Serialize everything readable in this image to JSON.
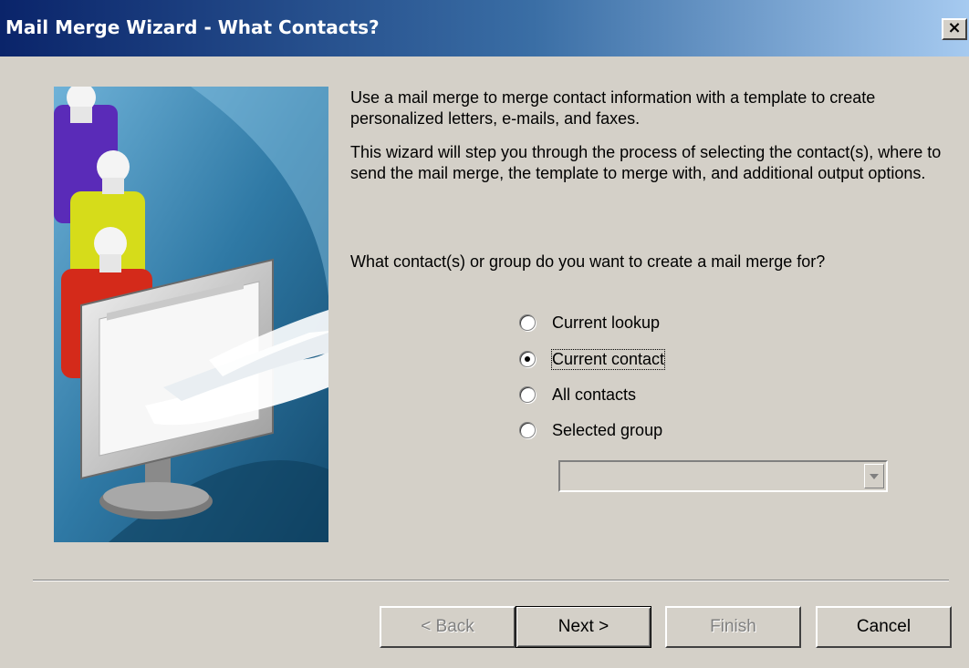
{
  "window": {
    "title": "Mail Merge Wizard - What Contacts?",
    "close_label": "×"
  },
  "intro": {
    "paragraph1": "Use a mail merge to merge contact information with a template to create personalized letters, e-mails, and faxes.",
    "paragraph2": "This wizard will step you through the process of selecting the contact(s), where to send the mail merge, the template to merge with, and additional output options.",
    "question": "What contact(s) or group do you want to create a mail merge for?"
  },
  "options": [
    {
      "label": "Current lookup",
      "checked": false
    },
    {
      "label": "Current contact",
      "checked": true
    },
    {
      "label": "All contacts",
      "checked": false
    },
    {
      "label": "Selected group",
      "checked": false
    }
  ],
  "group_select": {
    "value": "",
    "enabled": false
  },
  "buttons": {
    "back": "< Back",
    "next": "Next >",
    "finish": "Finish",
    "cancel": "Cancel"
  },
  "icons": {
    "close": "close-icon",
    "dropdown": "chevron-down-icon",
    "illustration": "mail-merge-illustration"
  }
}
